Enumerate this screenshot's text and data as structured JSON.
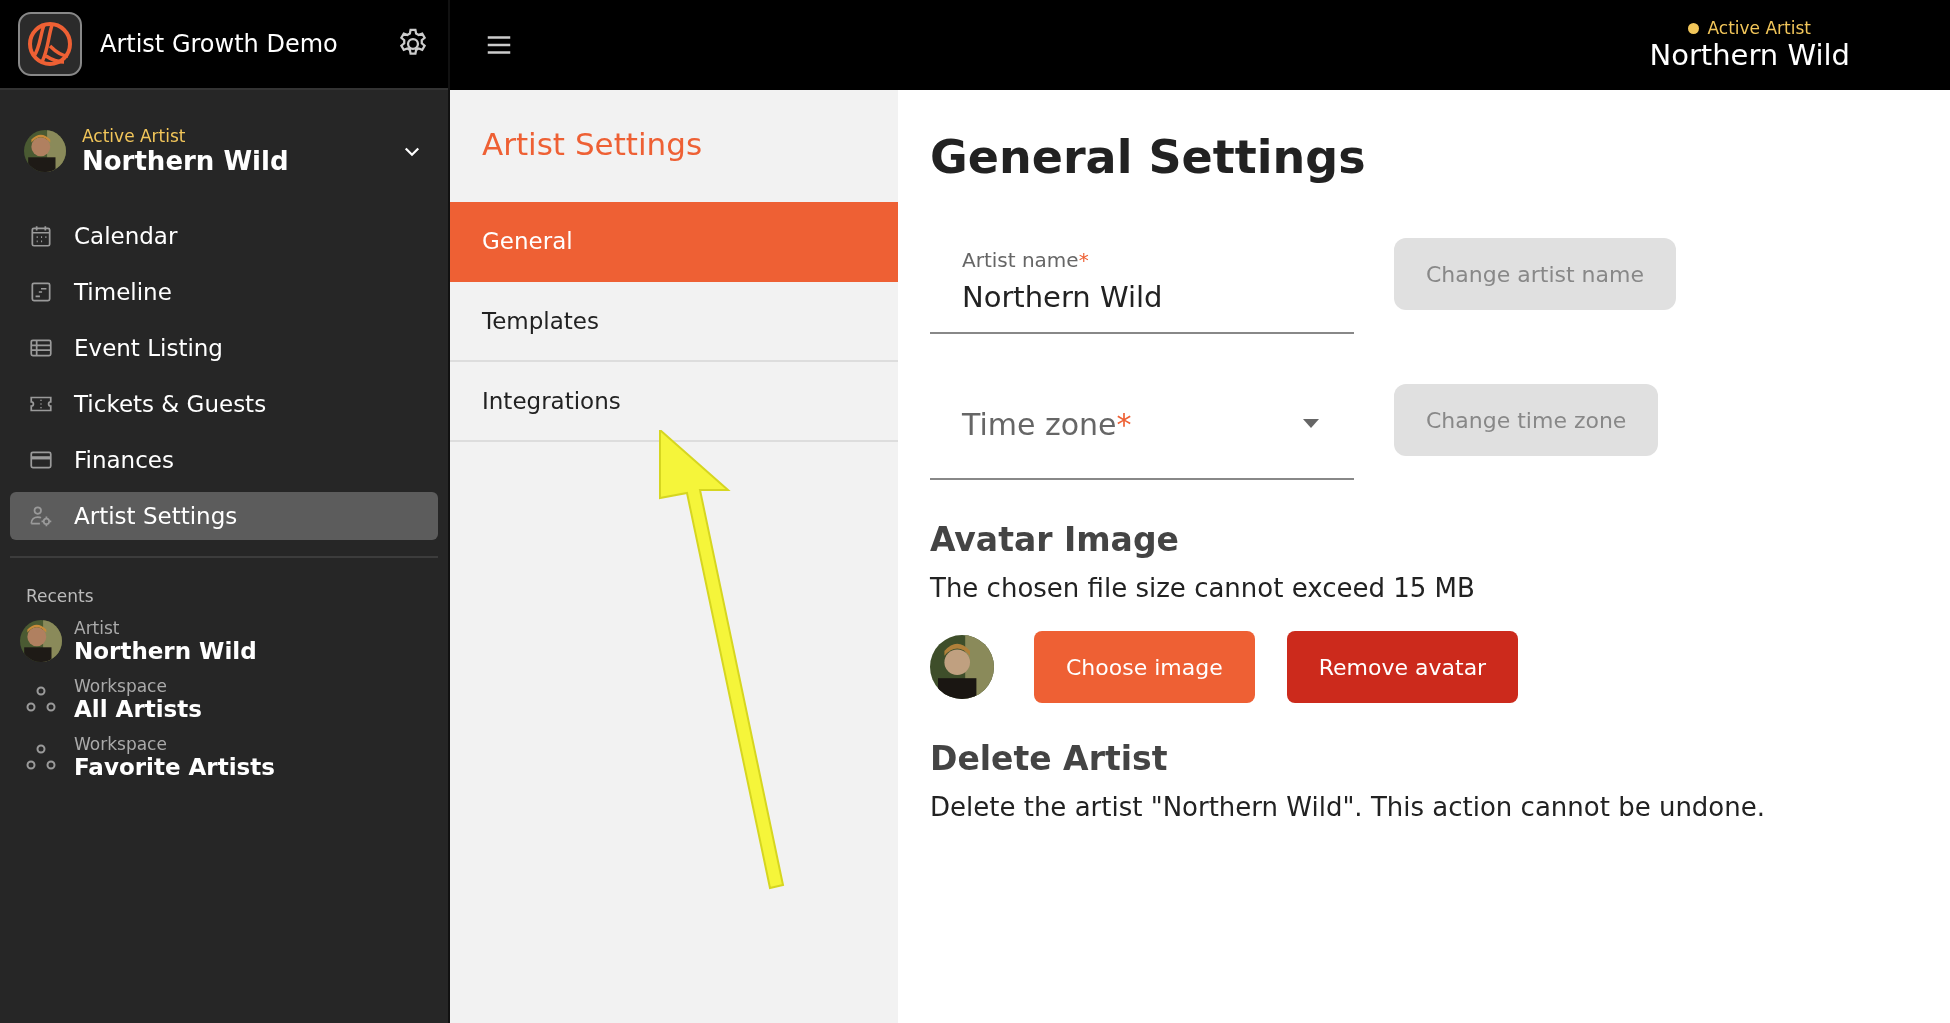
{
  "app": {
    "title": "Artist Growth Demo"
  },
  "active_artist": {
    "label": "Active Artist",
    "name": "Northern Wild"
  },
  "nav": [
    {
      "label": "Calendar",
      "kind": "calendar",
      "selected": false
    },
    {
      "label": "Timeline",
      "kind": "timeline",
      "selected": false
    },
    {
      "label": "Event Listing",
      "kind": "list",
      "selected": false
    },
    {
      "label": "Tickets & Guests",
      "kind": "ticket",
      "selected": false
    },
    {
      "label": "Finances",
      "kind": "card",
      "selected": false
    },
    {
      "label": "Artist Settings",
      "kind": "settings",
      "selected": true
    }
  ],
  "recents": {
    "title": "Recents",
    "items": [
      {
        "kind": "artist",
        "type": "Artist",
        "name": "Northern Wild"
      },
      {
        "kind": "workspace",
        "type": "Workspace",
        "name": "All Artists"
      },
      {
        "kind": "workspace",
        "type": "Workspace",
        "name": "Favorite Artists"
      }
    ]
  },
  "header": {
    "label": "Active Artist",
    "name": "Northern Wild"
  },
  "settings_nav": {
    "title": "Artist Settings",
    "items": [
      {
        "label": "General",
        "selected": true
      },
      {
        "label": "Templates",
        "selected": false
      },
      {
        "label": "Integrations",
        "selected": false
      }
    ]
  },
  "content": {
    "title": "General Settings",
    "artist_name": {
      "label": "Artist name",
      "required_mark": "*",
      "value": "Northern Wild",
      "button": "Change artist name"
    },
    "time_zone": {
      "placeholder": "Time zone",
      "required_mark": "*",
      "button": "Change time zone"
    },
    "avatar": {
      "title": "Avatar Image",
      "note": "The chosen file size cannot exceed 15 MB",
      "buttons": [
        "Choose image",
        "Remove avatar"
      ]
    },
    "delete": {
      "title": "Delete Artist",
      "note": "Delete the artist \"Northern Wild\". This action cannot be undone."
    }
  },
  "annotation": {
    "kind": "arrow"
  }
}
